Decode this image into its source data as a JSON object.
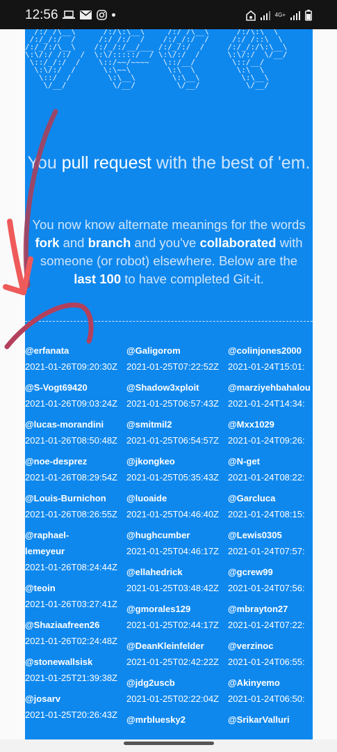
{
  "status_bar": {
    "time": "12:56",
    "icons": [
      "laptop-icon",
      "mail-icon",
      "instagram-icon",
      "dot-icon",
      "wifi-calling-icon",
      "signal-icon",
      "4g-icon",
      "signal-icon",
      "battery-icon"
    ],
    "network_label": "4G+"
  },
  "ascii_art": "  /:/ /\\__\\      /:/\\:\\__\\     /:/ /\\__\\      /:/\\:\\  \\\n /:/_/:/  /     /:/ /:/  /    /:/_/:/  /     /:/ /::\\  \\\n/:/_/:/\\__\\    /:/_/:/__/___ /:/_/:/  /     /:/_/:/\\:\\__\\\n\\:\\/:/ /:/  /  \\:\\/:::::/  / \\:\\/:/  /      \\:\\/:/  \\/__/\n \\::/_/:/  /    \\::/~~/~~~~   \\::/__/        \\::/__/\n  \\:\\/:/  /      \\:\\~~\\        \\:\\  \\         \\:\\  \\\n   \\::/  /        \\:\\__\\        \\:\\__\\         \\:\\__\\\n    \\/__/          \\/__/         \\/__/          \\/__/",
  "hero": {
    "pre": "You ",
    "bold": "pull request",
    "post": " with the best of 'em."
  },
  "subtitle": {
    "p1": "You now know alternate meanings for the words ",
    "b1": "fork",
    "p2": " and ",
    "b2": "branch",
    "p3": " and you've ",
    "b3": "collaborated",
    "p4": " with someone (or robot) elsewhere. Below are the ",
    "b4": "last 100",
    "p5": " to have completed Git-it."
  },
  "columns": [
    [
      {
        "user": "@erfanata",
        "time": "2021-01-26T09:20:30Z"
      },
      {
        "user": "@S-Vogt69420",
        "time": "2021-01-26T09:03:24Z"
      },
      {
        "user": "@lucas-morandini",
        "time": "2021-01-26T08:50:48Z"
      },
      {
        "user": "@noe-desprez",
        "time": "2021-01-26T08:29:54Z"
      },
      {
        "user": "@Louis-Burnichon",
        "time": "2021-01-26T08:26:55Z"
      },
      {
        "user": "@raphael-lemeyeur",
        "time": "2021-01-26T08:24:44Z"
      },
      {
        "user": "@teoin",
        "time": "2021-01-26T03:27:41Z"
      },
      {
        "user": "@Shaziaafreen26",
        "time": "2021-01-26T02:24:48Z"
      },
      {
        "user": "@stonewallsisk",
        "time": "2021-01-25T21:39:38Z"
      },
      {
        "user": "@josarv",
        "time": "2021-01-25T20:26:43Z"
      }
    ],
    [
      {
        "user": "@Galigorom",
        "time": "2021-01-25T07:22:52Z"
      },
      {
        "user": "@Shadow3xploit",
        "time": "2021-01-25T06:57:43Z"
      },
      {
        "user": "@smitmil2",
        "time": "2021-01-25T06:54:57Z"
      },
      {
        "user": "@jkongkeo",
        "time": "2021-01-25T05:35:43Z"
      },
      {
        "user": "@luoaide",
        "time": "2021-01-25T04:46:40Z"
      },
      {
        "user": "@hughcumber",
        "time": "2021-01-25T04:46:17Z"
      },
      {
        "user": "@ellahedrick",
        "time": "2021-01-25T03:48:42Z"
      },
      {
        "user": "@gmorales129",
        "time": "2021-01-25T02:44:17Z"
      },
      {
        "user": "@DeanKleinfelder",
        "time": "2021-01-25T02:42:22Z"
      },
      {
        "user": "@jdg2uscb",
        "time": "2021-01-25T02:22:04Z"
      },
      {
        "user": "@mrbluesky2",
        "time": ""
      }
    ],
    [
      {
        "user": "@colinjones2000",
        "time": "2021-01-24T15:01:"
      },
      {
        "user": "@marziyehbahalou",
        "time": "2021-01-24T14:34:"
      },
      {
        "user": "@Mxx1029",
        "time": "2021-01-24T09:26:"
      },
      {
        "user": "@N-get",
        "time": "2021-01-24T08:22:"
      },
      {
        "user": "@Garcluca",
        "time": "2021-01-24T08:15:"
      },
      {
        "user": "@Lewis0305",
        "time": "2021-01-24T07:57:"
      },
      {
        "user": "@gcrew99",
        "time": "2021-01-24T07:56:"
      },
      {
        "user": "@mbrayton27",
        "time": "2021-01-24T07:22:"
      },
      {
        "user": "@verzinoc",
        "time": "2021-01-24T06:55:"
      },
      {
        "user": "@Akinyemo",
        "time": "2021-01-24T06:50:"
      },
      {
        "user": "@SrikarValluri",
        "time": ""
      }
    ]
  ]
}
